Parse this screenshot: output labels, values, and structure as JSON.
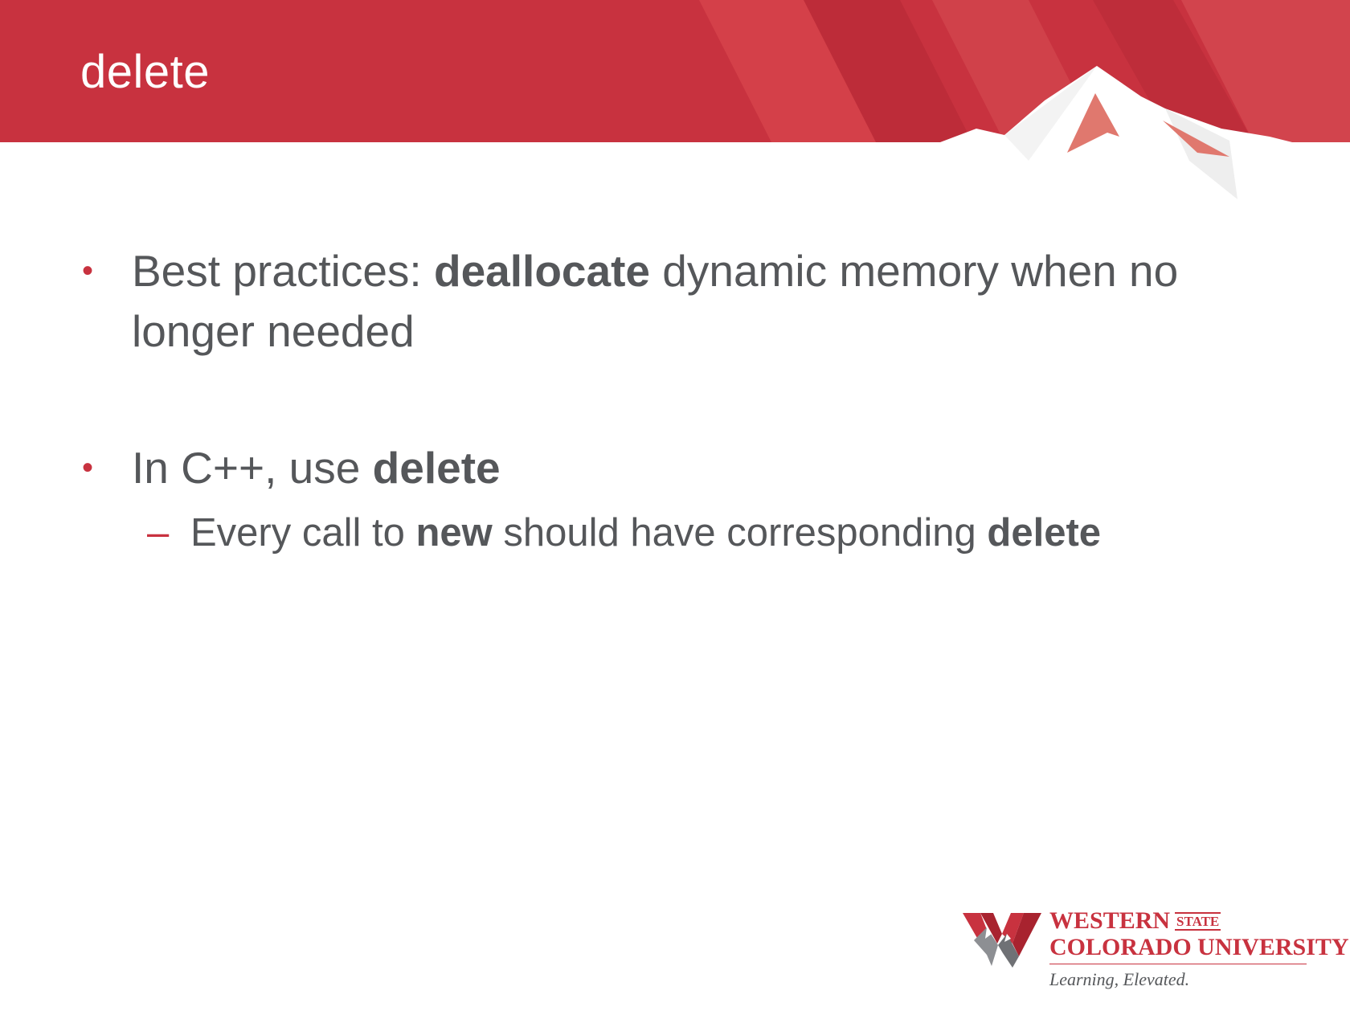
{
  "slide": {
    "title": "delete"
  },
  "bullets": [
    {
      "marker": "•",
      "parts": [
        {
          "text": "Best practices: ",
          "bold": false
        },
        {
          "text": "deallocate",
          "bold": true
        },
        {
          "text": " dynamic memory when no longer needed",
          "bold": false
        }
      ]
    },
    {
      "marker": "•",
      "parts": [
        {
          "text": "In C++, use ",
          "bold": false
        },
        {
          "text": "delete",
          "bold": true
        }
      ],
      "sub": {
        "marker": "–",
        "parts": [
          {
            "text": "Every call to ",
            "bold": false
          },
          {
            "text": "new",
            "bold": true
          },
          {
            "text": " should have corresponding ",
            "bold": false
          },
          {
            "text": "delete",
            "bold": true
          }
        ]
      }
    }
  ],
  "logo": {
    "line1": "WESTERN",
    "state": "STATE",
    "line2": "COLORADO UNIVERSITY",
    "tagline": "Learning, Elevated."
  },
  "colors": {
    "brand_red": "#c8323f",
    "text_gray": "#55575a"
  }
}
